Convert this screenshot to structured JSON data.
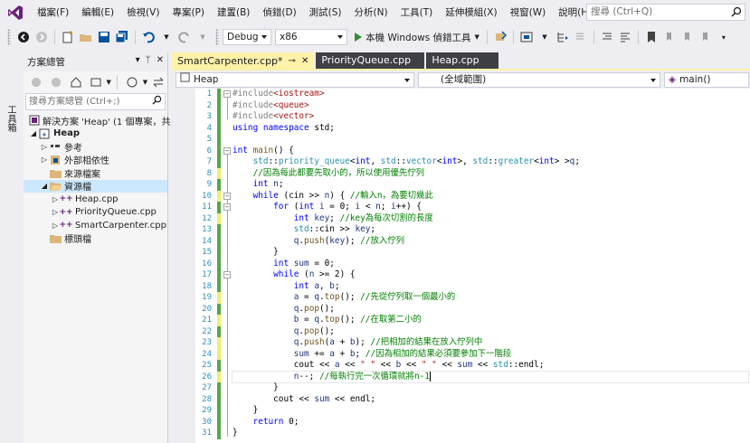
{
  "menu": {
    "items": [
      "檔案(F)",
      "編輯(E)",
      "檢視(V)",
      "專案(P)",
      "建置(B)",
      "偵錯(D)",
      "測試(S)",
      "分析(N)",
      "工具(T)",
      "延伸模組(X)",
      "視窗(W)",
      "說明(H)"
    ],
    "search_placeholder": "搜尋 (Ctrl+Q)"
  },
  "toolbar": {
    "config": "Debug",
    "platform": "x86",
    "run_label": "本機 Windows 偵錯工具"
  },
  "left_strip": {
    "toolbox_label": "工具箱"
  },
  "solution_explorer": {
    "title": "方案總管",
    "search_placeholder": "搜尋方案總管 (Ctrl+;)",
    "tree": [
      {
        "label": "解決方案 'Heap' (1 個專案，共",
        "icon": "solution-icon",
        "expander": ""
      },
      {
        "label": "Heap",
        "icon": "project-icon",
        "expander": "◢",
        "bold": true
      },
      {
        "label": "參考",
        "icon": "references-icon",
        "expander": "▷"
      },
      {
        "label": "外部相依性",
        "icon": "external-deps-icon",
        "expander": "▷"
      },
      {
        "label": "來源檔案",
        "icon": "folder-icon",
        "expander": ""
      },
      {
        "label": "資源檔",
        "icon": "folder-icon",
        "expander": "◢",
        "selected": true
      },
      {
        "label": "Heap.cpp",
        "icon": "cpp-file-icon",
        "expander": "▷"
      },
      {
        "label": "PriorityQueue.cpp",
        "icon": "cpp-file-icon",
        "expander": "▷"
      },
      {
        "label": "SmartCarpenter.cpp",
        "icon": "cpp-file-icon",
        "expander": "▷"
      },
      {
        "label": "標頭檔",
        "icon": "folder-icon",
        "expander": ""
      }
    ]
  },
  "editor": {
    "tabs": [
      {
        "label": "SmartCarpenter.cpp*",
        "active": true
      },
      {
        "label": "PriorityQueue.cpp",
        "active": false
      },
      {
        "label": "Heap.cpp",
        "active": false
      }
    ],
    "nav": {
      "project": "Heap",
      "scope": "(全域範圍)",
      "member": "main()"
    },
    "line_numbers": [
      "1",
      "2",
      "3",
      "4",
      "5",
      "6",
      "7",
      "8",
      "9",
      "10",
      "11",
      "12",
      "13",
      "14",
      "15",
      "16",
      "17",
      "18",
      "19",
      "20",
      "21",
      "22",
      "23",
      "24",
      "25",
      "26",
      "27",
      "28",
      "29",
      "30",
      "31"
    ]
  }
}
